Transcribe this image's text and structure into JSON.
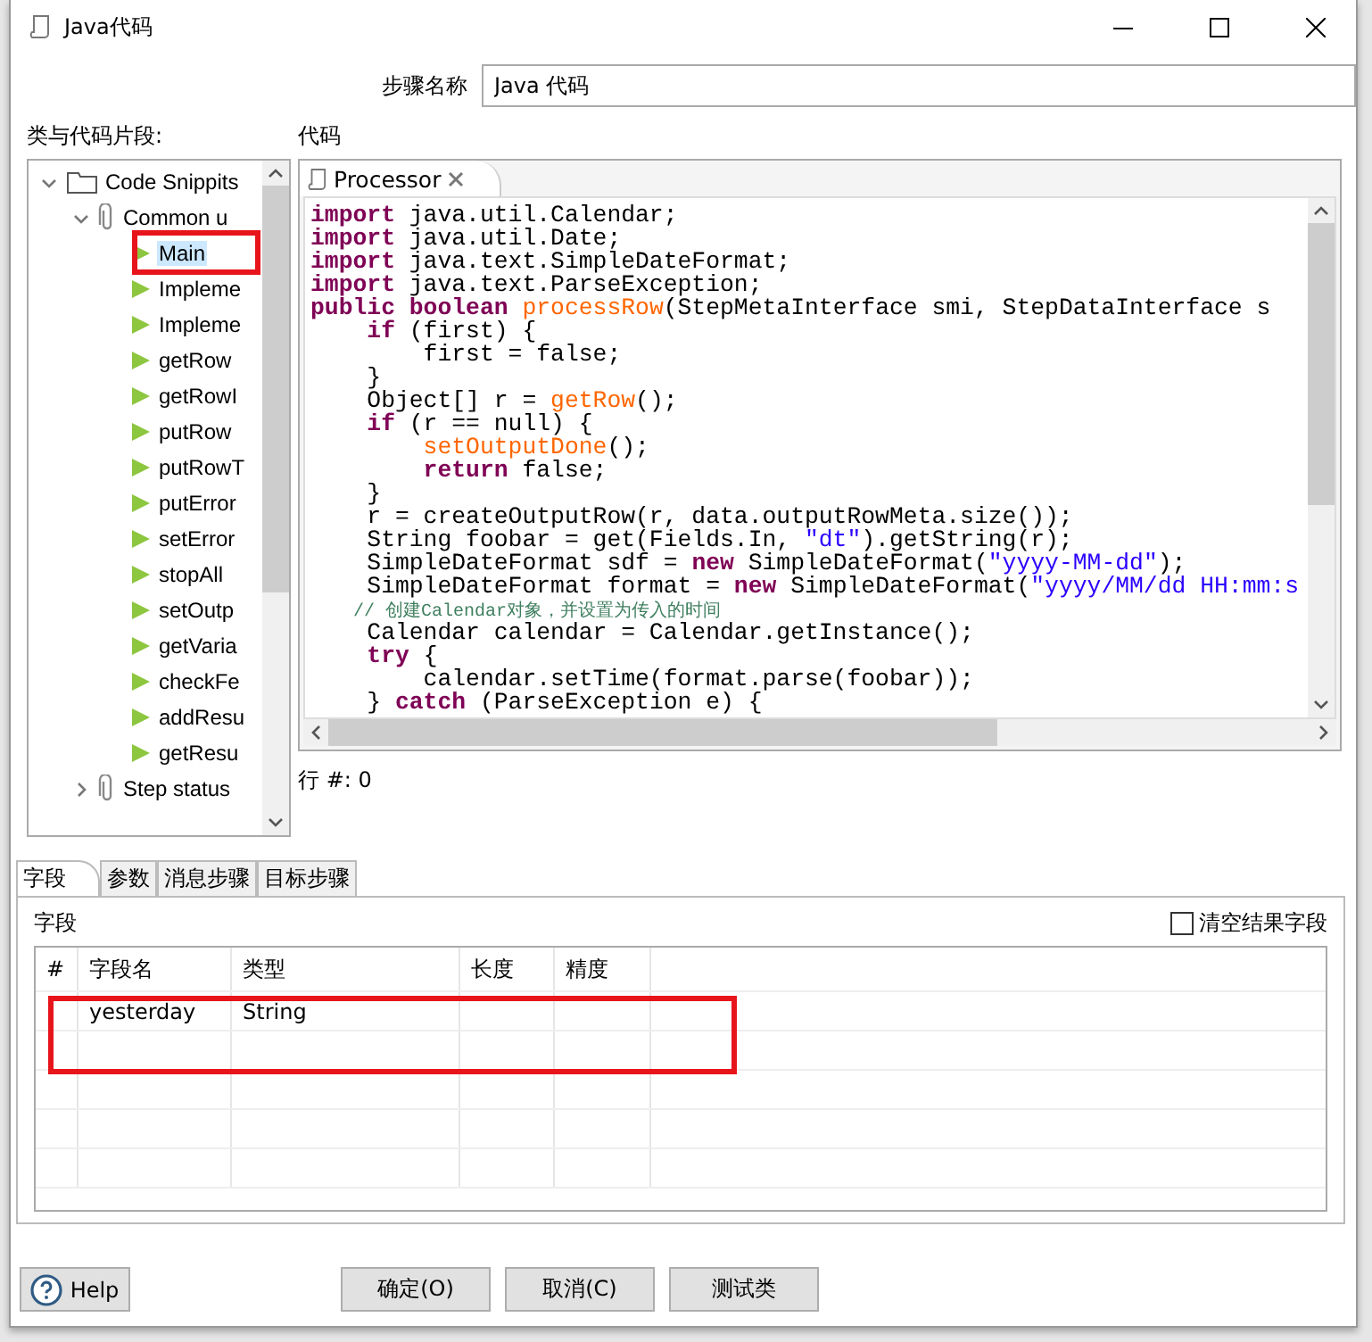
{
  "window": {
    "title": "Java代码"
  },
  "step_name": {
    "label": "步骤名称",
    "value": "Java 代码"
  },
  "snippets": {
    "label": "类与代码片段:",
    "tree": [
      {
        "label": "Code Snippits",
        "kind": "folder",
        "expanded": true,
        "selected": false,
        "highlighted": false,
        "children": [
          {
            "label": "Common u",
            "kind": "clip",
            "expanded": true,
            "selected": false,
            "highlighted": false,
            "children": [
              {
                "label": "Main",
                "kind": "snippet",
                "selected": true,
                "highlighted": true
              },
              {
                "label": "Impleme",
                "kind": "snippet",
                "selected": false,
                "highlighted": false
              },
              {
                "label": "Impleme",
                "kind": "snippet",
                "selected": false,
                "highlighted": false
              },
              {
                "label": "getRow",
                "kind": "snippet",
                "selected": false,
                "highlighted": false
              },
              {
                "label": "getRowI",
                "kind": "snippet",
                "selected": false,
                "highlighted": false
              },
              {
                "label": "putRow",
                "kind": "snippet",
                "selected": false,
                "highlighted": false
              },
              {
                "label": "putRowT",
                "kind": "snippet",
                "selected": false,
                "highlighted": false
              },
              {
                "label": "putError",
                "kind": "snippet",
                "selected": false,
                "highlighted": false
              },
              {
                "label": "setError",
                "kind": "snippet",
                "selected": false,
                "highlighted": false
              },
              {
                "label": "stopAll",
                "kind": "snippet",
                "selected": false,
                "highlighted": false
              },
              {
                "label": "setOutp",
                "kind": "snippet",
                "selected": false,
                "highlighted": false
              },
              {
                "label": "getVaria",
                "kind": "snippet",
                "selected": false,
                "highlighted": false
              },
              {
                "label": "checkFe",
                "kind": "snippet",
                "selected": false,
                "highlighted": false
              },
              {
                "label": "addResu",
                "kind": "snippet",
                "selected": false,
                "highlighted": false
              },
              {
                "label": "getResu",
                "kind": "snippet",
                "selected": false,
                "highlighted": false
              }
            ]
          },
          {
            "label": "Step status",
            "kind": "clip",
            "expanded": false,
            "selected": false,
            "highlighted": false
          }
        ]
      }
    ]
  },
  "code": {
    "label": "代码",
    "tab": "Processor",
    "status": "行 #: 0",
    "lines": [
      [
        {
          "kind": "kw",
          "text": "import"
        },
        {
          "kind": "plain",
          "text": " java.util.Calendar;"
        }
      ],
      [
        {
          "kind": "kw",
          "text": "import"
        },
        {
          "kind": "plain",
          "text": " java.util.Date;"
        }
      ],
      [
        {
          "kind": "kw",
          "text": "import"
        },
        {
          "kind": "plain",
          "text": " java.text.SimpleDateFormat;"
        }
      ],
      [
        {
          "kind": "kw",
          "text": "import"
        },
        {
          "kind": "plain",
          "text": " java.text.ParseException;"
        }
      ],
      [
        {
          "kind": "kw",
          "text": "public boolean "
        },
        {
          "kind": "fn",
          "text": "processRow"
        },
        {
          "kind": "plain",
          "text": "(StepMetaInterface smi, StepDataInterface s"
        }
      ],
      [
        {
          "kind": "kw",
          "text": "    if"
        },
        {
          "kind": "plain",
          "text": " (first) {"
        }
      ],
      [
        {
          "kind": "plain",
          "text": "        first = false;"
        }
      ],
      [
        {
          "kind": "plain",
          "text": "    }"
        }
      ],
      [
        {
          "kind": "plain",
          "text": "    Object[] r = "
        },
        {
          "kind": "fn",
          "text": "getRow"
        },
        {
          "kind": "plain",
          "text": "();"
        }
      ],
      [
        {
          "kind": "kw",
          "text": "    if"
        },
        {
          "kind": "plain",
          "text": " (r == null) {"
        }
      ],
      [
        {
          "kind": "fn",
          "text": "        setOutputDone"
        },
        {
          "kind": "plain",
          "text": "();"
        }
      ],
      [
        {
          "kind": "kw",
          "text": "        return"
        },
        {
          "kind": "plain",
          "text": " false;"
        }
      ],
      [
        {
          "kind": "plain",
          "text": "    }"
        }
      ],
      [
        {
          "kind": "plain",
          "text": "    r = createOutputRow(r, data.outputRowMeta.size());"
        }
      ],
      [
        {
          "kind": "plain",
          "text": "    String foobar = get(Fields.In, "
        },
        {
          "kind": "str",
          "text": "\"dt\""
        },
        {
          "kind": "plain",
          "text": ").getString(r);"
        }
      ],
      [
        {
          "kind": "plain",
          "text": "    SimpleDateFormat sdf = "
        },
        {
          "kind": "kw",
          "text": "new"
        },
        {
          "kind": "plain",
          "text": " SimpleDateFormat("
        },
        {
          "kind": "str",
          "text": "\"yyyy-MM-dd\""
        },
        {
          "kind": "plain",
          "text": ");"
        }
      ],
      [
        {
          "kind": "plain",
          "text": "    SimpleDateFormat format = "
        },
        {
          "kind": "kw",
          "text": "new"
        },
        {
          "kind": "plain",
          "text": " SimpleDateFormat("
        },
        {
          "kind": "str",
          "text": "\"yyyy/MM/dd HH:mm:s"
        }
      ],
      [
        {
          "kind": "comment",
          "text": "    // 创建Calendar对象，并设置为传入的时间"
        }
      ],
      [
        {
          "kind": "plain",
          "text": "    Calendar calendar = Calendar.getInstance();"
        }
      ],
      [
        {
          "kind": "kw",
          "text": "    try"
        },
        {
          "kind": "plain",
          "text": " {"
        }
      ],
      [
        {
          "kind": "plain",
          "text": "        calendar.setTime(format.parse(foobar));"
        }
      ],
      [
        {
          "kind": "plain",
          "text": "    } "
        },
        {
          "kind": "kw",
          "text": "catch"
        },
        {
          "kind": "plain",
          "text": " (ParseException e) {"
        }
      ]
    ]
  },
  "bottom_tabs": [
    {
      "label": "字段",
      "selected": true
    },
    {
      "label": "参数",
      "selected": false
    },
    {
      "label": "消息步骤",
      "selected": false
    },
    {
      "label": "目标步骤",
      "selected": false
    }
  ],
  "fields": {
    "label": "字段",
    "clear_checkbox": {
      "label": "清空结果字段",
      "checked": false
    },
    "columns": [
      "#",
      "字段名",
      "类型",
      "长度",
      "精度"
    ],
    "rows": [
      {
        "cells": [
          "",
          "yesterday",
          "String",
          "",
          ""
        ],
        "highlighted": true
      },
      {
        "cells": [
          "",
          "",
          "",
          "",
          ""
        ],
        "highlighted": true
      },
      {
        "cells": [
          "",
          "",
          "",
          "",
          ""
        ],
        "highlighted": false
      },
      {
        "cells": [
          "",
          "",
          "",
          "",
          ""
        ],
        "highlighted": false
      },
      {
        "cells": [
          "",
          "",
          "",
          "",
          ""
        ],
        "highlighted": false
      }
    ]
  },
  "buttons": {
    "help": "Help",
    "actions": [
      "确定(O)",
      "取消(C)",
      "测试类"
    ]
  }
}
